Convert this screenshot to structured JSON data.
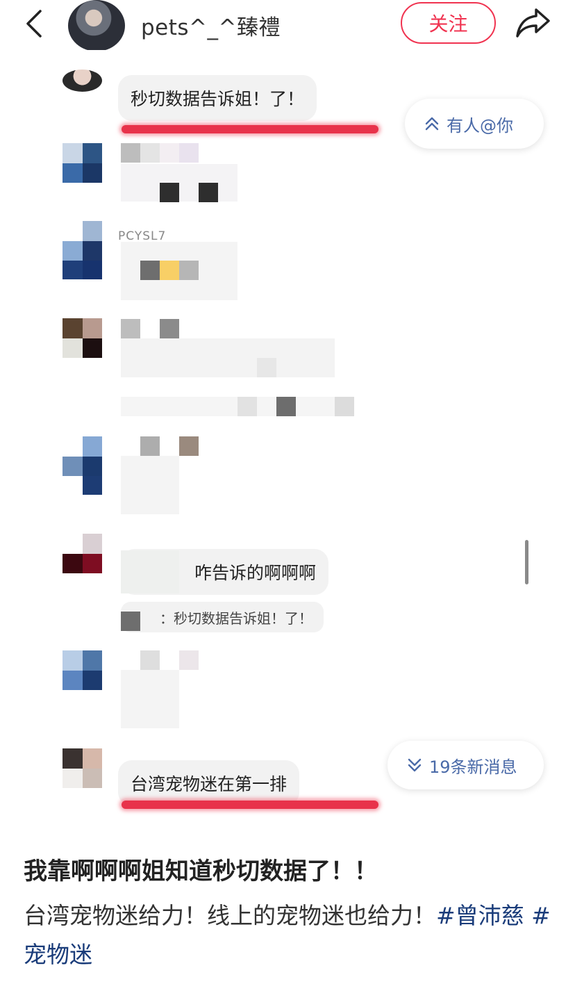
{
  "header": {
    "author_name": "pets^_^臻禮",
    "follow_label": "关注"
  },
  "chat": {
    "message1": "秒切数据告诉姐！了！",
    "mention_pill": "有人@你",
    "partial_text": "PCYSL7",
    "message2": "咋告诉的啊啊啊",
    "quoted_text": "：秒切数据告诉姐！了！",
    "message3": "台湾宠物迷在第一排",
    "new_messages_pill": "19条新消息"
  },
  "caption": {
    "title": "我靠啊啊啊姐知道秒切数据了！！",
    "body": "台湾宠物迷给力！线上的宠物迷也给力！",
    "tag1": "#曾沛慈",
    "tag2": "#宠物迷"
  },
  "colors": {
    "accent": "#f03350",
    "tag": "#1a3c7a",
    "pill_text": "#4a6aa8",
    "underline": "#e8324a"
  },
  "icons": {
    "back": "chevron-left-icon",
    "share": "share-arrow-icon",
    "mention": "double-chevron-up-icon",
    "new_messages": "double-chevron-down-icon"
  }
}
